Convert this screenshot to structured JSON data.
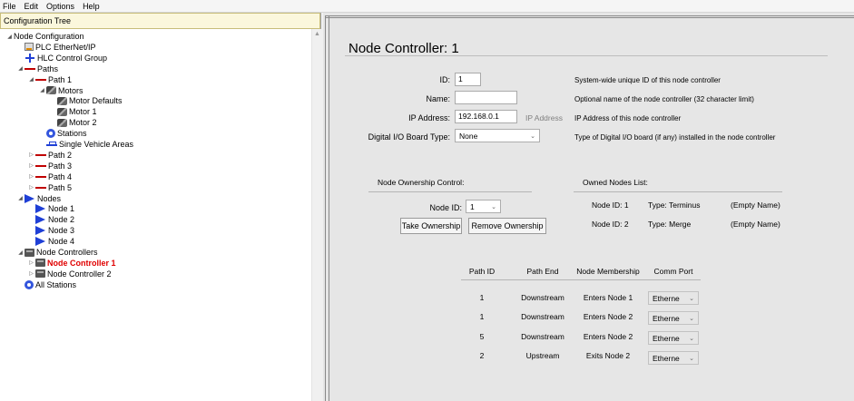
{
  "menu": [
    "File",
    "Edit",
    "Options",
    "Help"
  ],
  "left_panel": {
    "header": "Configuration Tree",
    "tree": [
      {
        "label": "Node Configuration",
        "depth": 0,
        "expander": "open",
        "icon": "none"
      },
      {
        "label": "PLC EtherNet/IP",
        "depth": 1,
        "expander": "none",
        "icon": "plc"
      },
      {
        "label": "HLC Control Group",
        "depth": 1,
        "expander": "none",
        "icon": "hlc"
      },
      {
        "label": "Paths",
        "depth": 1,
        "expander": "open",
        "icon": "path"
      },
      {
        "label": "Path 1",
        "depth": 2,
        "expander": "open",
        "icon": "path"
      },
      {
        "label": "Motors",
        "depth": 3,
        "expander": "open",
        "icon": "motor"
      },
      {
        "label": "Motor Defaults",
        "depth": 4,
        "expander": "none",
        "icon": "motor"
      },
      {
        "label": "Motor 1",
        "depth": 4,
        "expander": "none",
        "icon": "motor"
      },
      {
        "label": "Motor 2",
        "depth": 4,
        "expander": "none",
        "icon": "motor"
      },
      {
        "label": "Stations",
        "depth": 3,
        "expander": "none",
        "icon": "station"
      },
      {
        "label": "Single Vehicle Areas",
        "depth": 3,
        "expander": "none",
        "icon": "sva"
      },
      {
        "label": "Path 2",
        "depth": 2,
        "expander": "closed",
        "icon": "path"
      },
      {
        "label": "Path 3",
        "depth": 2,
        "expander": "closed",
        "icon": "path"
      },
      {
        "label": "Path 4",
        "depth": 2,
        "expander": "closed",
        "icon": "path"
      },
      {
        "label": "Path 5",
        "depth": 2,
        "expander": "closed",
        "icon": "path"
      },
      {
        "label": "Nodes",
        "depth": 1,
        "expander": "open",
        "icon": "node"
      },
      {
        "label": "Node 1",
        "depth": 2,
        "expander": "none",
        "icon": "node"
      },
      {
        "label": "Node 2",
        "depth": 2,
        "expander": "none",
        "icon": "node"
      },
      {
        "label": "Node 3",
        "depth": 2,
        "expander": "none",
        "icon": "node"
      },
      {
        "label": "Node 4",
        "depth": 2,
        "expander": "none",
        "icon": "node"
      },
      {
        "label": "Node Controllers",
        "depth": 1,
        "expander": "open",
        "icon": "ctrl"
      },
      {
        "label": "Node Controller 1",
        "depth": 2,
        "expander": "closed",
        "icon": "ctrl",
        "selected": true
      },
      {
        "label": "Node Controller 2",
        "depth": 2,
        "expander": "closed",
        "icon": "ctrl"
      },
      {
        "label": "All Stations",
        "depth": 1,
        "expander": "none",
        "icon": "station"
      }
    ]
  },
  "main": {
    "title": "Node Controller:  1",
    "fields": {
      "id_label": "ID:",
      "id_value": "1",
      "id_desc": "System-wide unique ID of this node controller",
      "name_label": "Name:",
      "name_value": "",
      "name_desc": "Optional name of the node controller (32 character limit)",
      "ip_label": "IP Address:",
      "ip_value": "192.168.0.1",
      "ip_ghost": "IP Address",
      "ip_desc": "IP Address of this node controller",
      "dio_label": "Digital I/O Board Type:",
      "dio_value": "None",
      "dio_desc": "Type of Digital I/O board (if any) installed in the node controller"
    },
    "ownership": {
      "heading": "Node Ownership Control:",
      "node_id_label": "Node ID:",
      "node_id_value": "1",
      "take_button": "Take Ownership",
      "remove_button": "Remove Ownership"
    },
    "owned_nodes": {
      "heading": "Owned Nodes List:",
      "items": [
        {
          "id": "Node ID: 1",
          "type": "Type: Terminus",
          "name": "(Empty Name)"
        },
        {
          "id": "Node ID: 2",
          "type": "Type: Merge",
          "name": "(Empty Name)"
        }
      ]
    },
    "path_table": {
      "headers": [
        "Path ID",
        "Path End",
        "Node Membership",
        "Comm Port"
      ],
      "rows": [
        {
          "path_id": "1",
          "path_end": "Downstream",
          "membership": "Enters Node 1",
          "comm_port": "Etherne"
        },
        {
          "path_id": "1",
          "path_end": "Downstream",
          "membership": "Enters Node 2",
          "comm_port": "Etherne"
        },
        {
          "path_id": "5",
          "path_end": "Downstream",
          "membership": "Enters Node 2",
          "comm_port": "Etherne"
        },
        {
          "path_id": "2",
          "path_end": "Upstream",
          "membership": "Exits Node 2",
          "comm_port": "Etherne"
        }
      ]
    }
  },
  "colors": {
    "selected_text": "#e00000",
    "path_red": "#c00000",
    "node_blue": "#1f3fd6",
    "header_bg": "#fbf7dc"
  }
}
